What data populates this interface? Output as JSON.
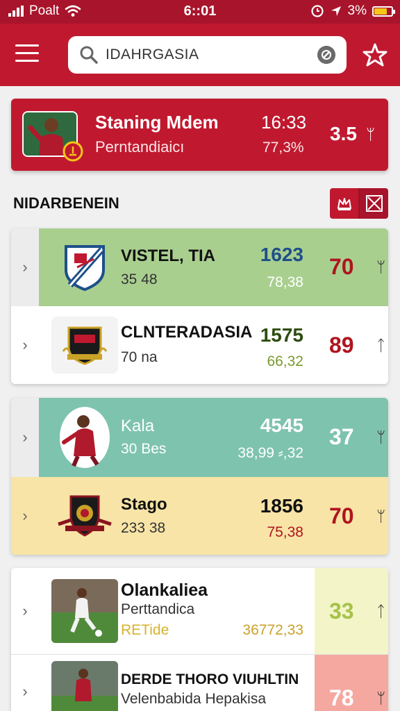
{
  "status_bar": {
    "carrier": "Poalt",
    "time": "6::01",
    "battery": "3%"
  },
  "search": {
    "value": "IDAHRGASIA"
  },
  "featured": {
    "title": "Staning Mdem",
    "subtitle": "Perntandiaicı",
    "time": "16:33",
    "percent": "77,3%",
    "score": "3.5",
    "trend": "ᛘ"
  },
  "section": {
    "title": "NIDARBENEIN"
  },
  "groups": [
    {
      "rows": [
        {
          "name": "VISTEL, TIA",
          "sub": "35 48",
          "value": "1623",
          "value_color": "#1d4f8a",
          "sub_value": "78,38",
          "score": "70",
          "score_color": "#b0141f",
          "trend": "ᛘ"
        },
        {
          "name": "CLNTERADASIA",
          "sub": "70 na",
          "value": "1575",
          "value_color": "#2e4d0f",
          "sub_value": "66,32",
          "score": "89",
          "score_color": "#b0141f",
          "trend": "ᛏ"
        }
      ]
    },
    {
      "rows": [
        {
          "name": "Kala",
          "sub": "30 Bes",
          "value": "4545",
          "value_color": "#ffffff",
          "sub_value": "38,99 ⸗,32",
          "score": "37",
          "score_color": "#ffffff",
          "trend": "ᛘ"
        },
        {
          "name": "Stago",
          "sub": "233 38",
          "value": "1856",
          "value_color": "#111111",
          "sub_value": "75,38",
          "score": "70",
          "score_color": "#b0141f",
          "trend": "ᛘ"
        }
      ]
    },
    {
      "rows": [
        {
          "name": "Olankaliea",
          "sub": "Perttandica",
          "tag": "RETide",
          "sub_value": "36772,33",
          "score": "33",
          "score_color": "#a6c24a",
          "trend": "ᛏ"
        },
        {
          "name": "DERDE THORO VIUHLTIN",
          "sub": "Velenbabida Hepakisa",
          "score": "78",
          "score_color": "#ffffff",
          "trend": "ᛘ"
        }
      ]
    }
  ],
  "colors": {
    "brand": "#c0192f",
    "row_green": "#a9cf8f",
    "row_teal": "#7ec3ae",
    "row_yellow": "#f8e4a6",
    "row_lime": "#f3f5c8",
    "row_pink": "#f5a8a0"
  }
}
